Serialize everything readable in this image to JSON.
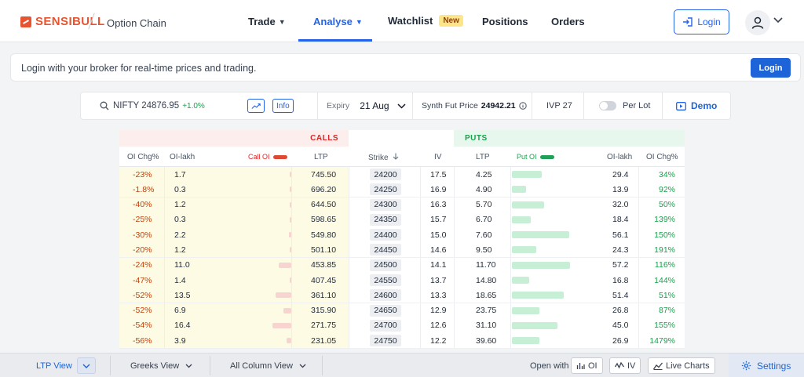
{
  "header": {
    "brand": "SENSIBULL",
    "page_name": "Option Chain",
    "nav": [
      {
        "label": "Trade"
      },
      {
        "label": "Analyse"
      },
      {
        "label": "Watchlist",
        "badge": "New"
      },
      {
        "label": "Positions"
      },
      {
        "label": "Orders"
      }
    ],
    "login_label": "Login"
  },
  "banner": {
    "text": "Login with your broker for real-time prices and trading.",
    "button": "Login"
  },
  "toolbar": {
    "symbol": "NIFTY 24876.95",
    "change": "+1.0%",
    "info_label": "Info",
    "expiry_label": "Expiry",
    "expiry_value": "21 Aug",
    "synth_label": "Synth Fut Price",
    "synth_value": "24942.21",
    "ivp": "IVP 27",
    "per_lot": "Per Lot",
    "demo": "Demo"
  },
  "chain": {
    "calls_label": "CALLS",
    "puts_label": "PUTS",
    "columns": {
      "oi_chg": "OI Chg%",
      "oi_lakh": "OI-lakh",
      "call_oi": "Call OI",
      "ltp": "LTP",
      "strike": "Strike",
      "iv": "IV",
      "put_ltp": "LTP",
      "put_oi": "Put OI",
      "put_oi_lakh": "OI-lakh",
      "put_oi_chg": "OI Chg%"
    },
    "rows": [
      {
        "call_chg": "-23%",
        "call_oi": "1.7",
        "call_ltp": "745.50",
        "strike": "24200",
        "iv": "17.5",
        "put_ltp": "4.25",
        "put_oi": "29.4",
        "put_chg": "34%"
      },
      {
        "call_chg": "-1.8%",
        "call_oi": "0.3",
        "call_ltp": "696.20",
        "strike": "24250",
        "iv": "16.9",
        "put_ltp": "4.90",
        "put_oi": "13.9",
        "put_chg": "92%"
      },
      {
        "call_chg": "-40%",
        "call_oi": "1.2",
        "call_ltp": "644.50",
        "strike": "24300",
        "iv": "16.3",
        "put_ltp": "5.70",
        "put_oi": "32.0",
        "put_chg": "50%"
      },
      {
        "call_chg": "-25%",
        "call_oi": "0.3",
        "call_ltp": "598.65",
        "strike": "24350",
        "iv": "15.7",
        "put_ltp": "6.70",
        "put_oi": "18.4",
        "put_chg": "139%"
      },
      {
        "call_chg": "-30%",
        "call_oi": "2.2",
        "call_ltp": "549.80",
        "strike": "24400",
        "iv": "15.0",
        "put_ltp": "7.60",
        "put_oi": "56.1",
        "put_chg": "150%"
      },
      {
        "call_chg": "-20%",
        "call_oi": "1.2",
        "call_ltp": "501.10",
        "strike": "24450",
        "iv": "14.6",
        "put_ltp": "9.50",
        "put_oi": "24.3",
        "put_chg": "191%"
      },
      {
        "call_chg": "-24%",
        "call_oi": "11.0",
        "call_ltp": "453.85",
        "strike": "24500",
        "iv": "14.1",
        "put_ltp": "11.70",
        "put_oi": "57.2",
        "put_chg": "116%"
      },
      {
        "call_chg": "-47%",
        "call_oi": "1.4",
        "call_ltp": "407.45",
        "strike": "24550",
        "iv": "13.7",
        "put_ltp": "14.80",
        "put_oi": "16.8",
        "put_chg": "144%"
      },
      {
        "call_chg": "-52%",
        "call_oi": "13.5",
        "call_ltp": "361.10",
        "strike": "24600",
        "iv": "13.3",
        "put_ltp": "18.65",
        "put_oi": "51.4",
        "put_chg": "51%"
      },
      {
        "call_chg": "-52%",
        "call_oi": "6.9",
        "call_ltp": "315.90",
        "strike": "24650",
        "iv": "12.9",
        "put_ltp": "23.75",
        "put_oi": "26.8",
        "put_chg": "87%"
      },
      {
        "call_chg": "-54%",
        "call_oi": "16.4",
        "call_ltp": "271.75",
        "strike": "24700",
        "iv": "12.6",
        "put_ltp": "31.10",
        "put_oi": "45.0",
        "put_chg": "155%"
      },
      {
        "call_chg": "-56%",
        "call_oi": "3.9",
        "call_ltp": "231.05",
        "strike": "24750",
        "iv": "12.2",
        "put_ltp": "39.60",
        "put_oi": "26.9",
        "put_chg": "1479%"
      }
    ]
  },
  "bottom_bar": {
    "ltp_view": "LTP View",
    "greeks_view": "Greeks View",
    "all_column_view": "All Column View",
    "open_with": "Open with",
    "oi": "OI",
    "iv": "IV",
    "live_charts": "Live Charts",
    "settings": "Settings"
  },
  "colors": {
    "brand": "#e8542f",
    "accent": "#2563eb",
    "calls": "#dc2626",
    "puts": "#16a34a"
  }
}
